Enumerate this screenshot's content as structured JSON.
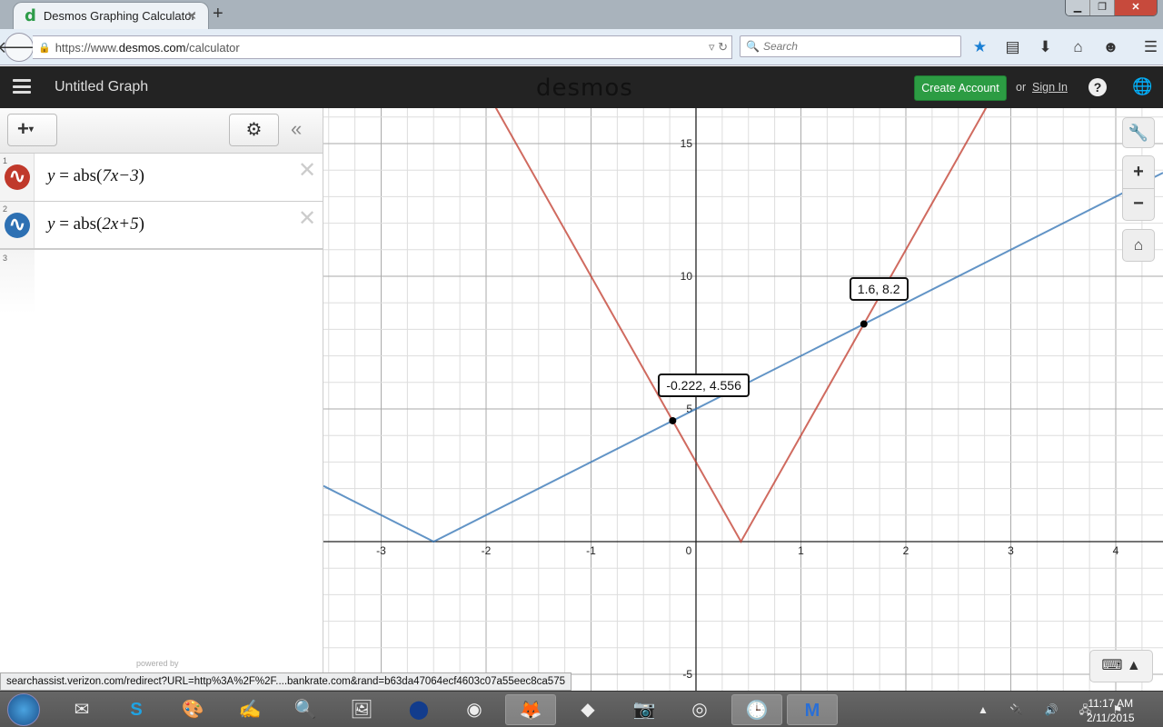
{
  "browser": {
    "tab_title": "Desmos Graphing Calculator",
    "tab_logo": "d",
    "url_prefix": "https://www.",
    "url_domain": "desmos.com",
    "url_path": "/calculator",
    "search_placeholder": "Search",
    "icons": [
      "bookmark-star-icon",
      "reading-list-icon",
      "download-icon",
      "home-icon",
      "chat-icon",
      "menu-icon"
    ],
    "status_url": "searchassist.verizon.com/redirect?URL=http%3A%2F%2F....bankrate.com&rand=b63da47064ecf4603c07a55eec8ca575"
  },
  "app": {
    "title": "Untitled Graph",
    "brand": "desmos",
    "create_account": "Create Account",
    "or": "or",
    "sign_in": "Sign In",
    "powered_by": "powered by"
  },
  "expressions": [
    {
      "num": "1",
      "lhs": "y",
      "fn": "abs",
      "arg": "7x−3",
      "color": "#c0392b"
    },
    {
      "num": "2",
      "lhs": "y",
      "fn": "abs",
      "arg": "2x+5",
      "color": "#2d70b3"
    },
    {
      "num": "3"
    }
  ],
  "graph": {
    "x_ticks": [
      "-3",
      "-2",
      "-1",
      "0",
      "1",
      "2",
      "3",
      "4"
    ],
    "y_ticks": [
      "15",
      "10",
      "5",
      "-5"
    ],
    "points": [
      {
        "label": "-0.222, 4.556",
        "x": -0.222,
        "y": 4.556
      },
      {
        "label": "1.6, 8.2",
        "x": 1.6,
        "y": 8.2
      }
    ],
    "curve_colors": {
      "red": "#c0392b",
      "blue": "#2d70b3"
    }
  },
  "taskbar": {
    "time": "11:17 AM",
    "date": "2/11/2015"
  }
}
